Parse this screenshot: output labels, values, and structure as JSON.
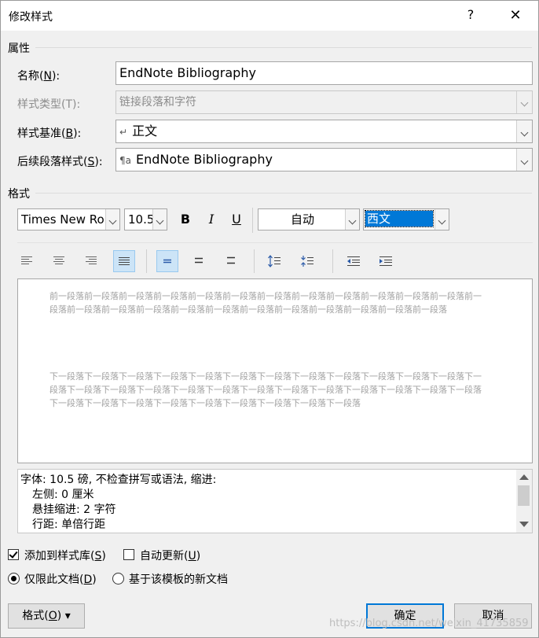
{
  "window": {
    "title": "修改样式",
    "help": "?",
    "close": "✕"
  },
  "properties": {
    "section": "属性",
    "name_label": "名称(N):",
    "name_label_pre": "名称(",
    "name_label_key": "N",
    "name_label_post": "):",
    "name_value": "EndNote Bibliography",
    "type_label": "样式类型(T):",
    "type_value": "链接段落和字符",
    "base_label_pre": "样式基准(",
    "base_label_key": "B",
    "base_label_post": "):",
    "base_glyph": "↵",
    "base_value": "正文",
    "next_label_pre": "后续段落样式(",
    "next_label_key": "S",
    "next_label_post": "):",
    "next_glyph": "¶a",
    "next_value": "EndNote Bibliography"
  },
  "format": {
    "section": "格式",
    "font": "Times New Ro",
    "size": "10.5",
    "bold": "B",
    "italic": "I",
    "underline": "U",
    "color": "自动",
    "script": "西文"
  },
  "preview": {
    "prev_text": "前一段落前一段落前一段落前一段落前一段落前一段落前一段落前一段落前一段落前一段落前一段落前一段落前一段落前一段落前一段落前一段落前一段落前一段落前一段落前一段落前一段落前一段落前一段落前一段落",
    "next_text": "下一段落下一段落下一段落下一段落下一段落下一段落下一段落下一段落下一段落下一段落下一段落下一段落下一段落下一段落下一段落下一段落下一段落下一段落下一段落下一段落下一段落下一段落下一段落下一段落下一段落下一段落下一段落下一段落下一段落下一段落下一段落下一段落下一段落下一段落"
  },
  "description": {
    "line1": "字体: 10.5 磅, 不检查拼写或语法, 缩进:",
    "line2": "左侧:  0 厘米",
    "line3": "悬挂缩进: 2 字符",
    "line4": "行距: 单倍行距"
  },
  "options": {
    "add_gallery_pre": "添加到样式库(",
    "add_gallery_key": "S",
    "add_gallery_post": ")",
    "add_gallery_checked": true,
    "auto_update_pre": "自动更新(",
    "auto_update_key": "U",
    "auto_update_post": ")",
    "auto_update_checked": false,
    "doc_only_pre": "仅限此文档(",
    "doc_only_key": "D",
    "doc_only_post": ")",
    "template_docs": "基于该模板的新文档",
    "selected_scope": "doc_only"
  },
  "buttons": {
    "format_pre": "格式(",
    "format_key": "O",
    "format_post": ")",
    "format_arrow": "▾",
    "ok": "确定",
    "cancel": "取消"
  },
  "watermark": "https://blog.csdn.net/weixin_41735859",
  "colors": {
    "accent": "#0078d7",
    "selection": "#0078d7",
    "active_button": "#cce4f7"
  }
}
